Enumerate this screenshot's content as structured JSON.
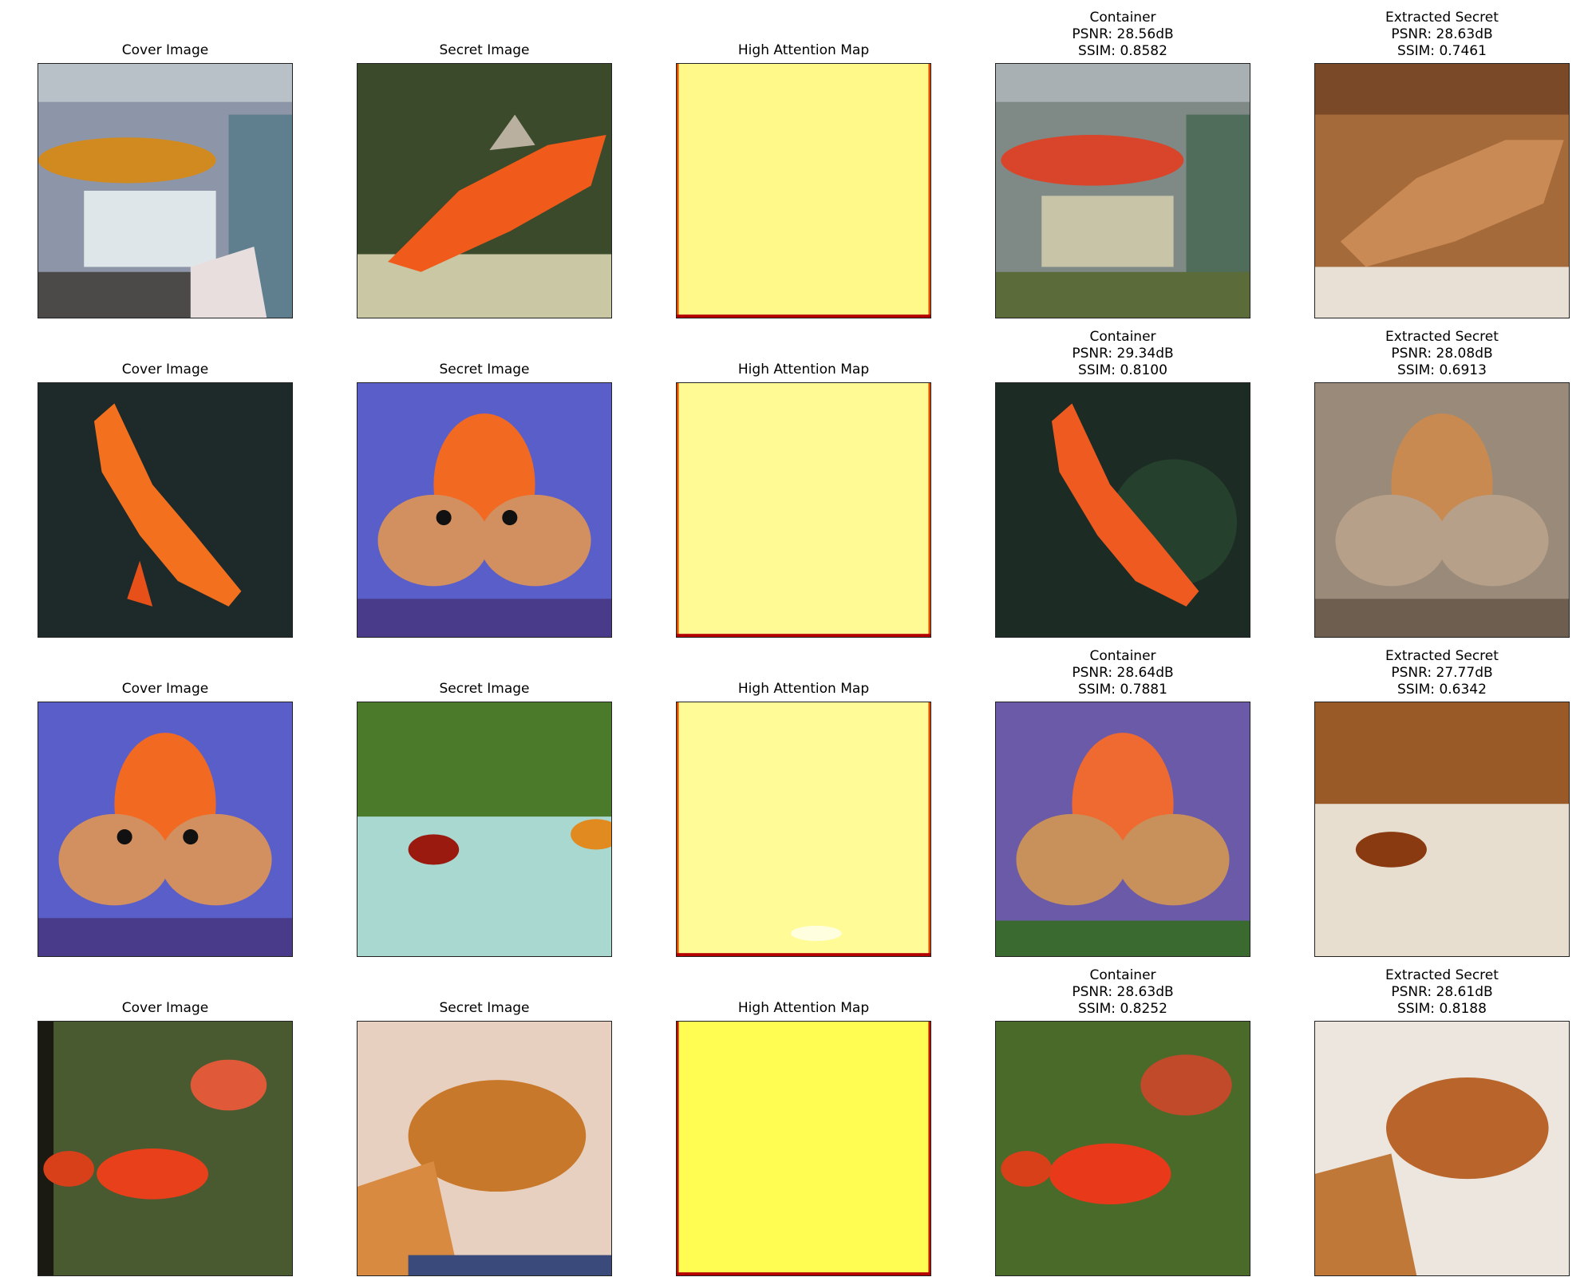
{
  "rows": [
    {
      "cover": "Cover Image",
      "secret": "Secret Image",
      "attention": "High Attention Map",
      "container": [
        "Container",
        "PSNR: 28.56dB",
        "SSIM: 0.8582"
      ],
      "extracted": [
        "Extracted Secret",
        "PSNR: 28.63dB",
        "SSIM: 0.7461"
      ]
    },
    {
      "cover": "Cover Image",
      "secret": "Secret Image",
      "attention": "High Attention Map",
      "container": [
        "Container",
        "PSNR: 29.34dB",
        "SSIM: 0.8100"
      ],
      "extracted": [
        "Extracted Secret",
        "PSNR: 28.08dB",
        "SSIM: 0.6913"
      ]
    },
    {
      "cover": "Cover Image",
      "secret": "Secret Image",
      "attention": "High Attention Map",
      "container": [
        "Container",
        "PSNR: 28.64dB",
        "SSIM: 0.7881"
      ],
      "extracted": [
        "Extracted Secret",
        "PSNR: 27.77dB",
        "SSIM: 0.6342"
      ]
    },
    {
      "cover": "Cover Image",
      "secret": "Secret Image",
      "attention": "High Attention Map",
      "container": [
        "Container",
        "PSNR: 28.63dB",
        "SSIM: 0.8252"
      ],
      "extracted": [
        "Extracted Secret",
        "PSNR: 28.61dB",
        "SSIM: 0.8188"
      ]
    }
  ],
  "colors": {
    "attention_fill": "#fff98a",
    "attention_edge": "#b40000",
    "goldfish": "#f06a1e",
    "water_dark": "#1e2a2a",
    "water_blue": "#5a5ec8",
    "extracted_tone": "#b0703a"
  }
}
